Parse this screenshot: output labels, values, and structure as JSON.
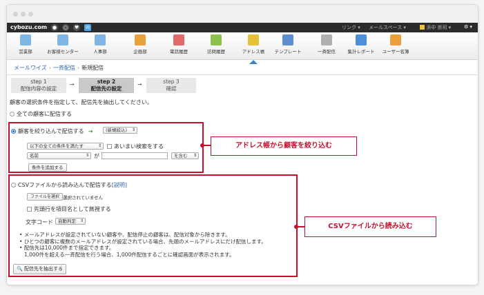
{
  "topbar": {
    "logo": "cybozu.com",
    "links": "リンク ▾",
    "mailspace": "メールスペース ▾",
    "user": "浜中 崇司 ▾",
    "settings": "⚙ ▾"
  },
  "apps": [
    {
      "label": "営業部"
    },
    {
      "label": "お客様センター"
    },
    {
      "label": "人事部"
    },
    {
      "label": "企画部"
    },
    {
      "label": "電話履歴"
    },
    {
      "label": "訪問履歴"
    },
    {
      "label": "アドレス帳"
    },
    {
      "label": "テンプレート"
    },
    {
      "label": "一斉配信"
    },
    {
      "label": "集計レポート"
    },
    {
      "label": "ユーザー名簿"
    }
  ],
  "breadcrumb": {
    "app": "メールワイズ",
    "section": "一斉配信",
    "current": "新規配信"
  },
  "steps": [
    {
      "title": "step 1",
      "label": "配信内容の設定"
    },
    {
      "title": "step 2",
      "label": "配信先の設定"
    },
    {
      "title": "step 3",
      "label": "確認"
    }
  ],
  "instruction": "顧客の選択条件を指定して、配信先を抽出してください。",
  "all_customers_label": "全ての顧客に配信する",
  "filter": {
    "label": "顧客を絞り込んで配信する",
    "filter_select": "(新規絞込)",
    "condition_select": "以下の全ての条件を満たす",
    "fuzzy_label": "あいまい検索をする",
    "field_select": "名前",
    "particle": "が",
    "match_select": "を含む",
    "add_condition": "条件を追加する"
  },
  "csv": {
    "label": "CSVファイルから読み込んで配信する",
    "help_link": "[説明]",
    "file_button": "ファイルを選択",
    "file_status": "選択されていません",
    "ignore_header": "先頭行を項目名として無視する",
    "charset_label": "文字コード",
    "charset_select": "自動判定"
  },
  "notes": [
    "メールアドレスが設定されていない顧客や、配信停止の顧客は、配信対象から除きます。",
    "ひとつの顧客に複数のメールアドレスが設定されている場合、先頭のメールアドレスにだけ配信します。",
    "配信先は10,000件まで指定できます。",
    "1,000件を超える一斉配信を行う場合、1,000件配信するごとに確認画面が表示されます。"
  ],
  "extract_button": "配信先を抽出する",
  "callouts": {
    "address_book": "アドレス帳から顧客を絞り込む",
    "csv": "CSVファイルから読み込む"
  },
  "colors": {
    "annotation": "#c8102e",
    "link": "#2a63b0",
    "topbar": "#2b2b2b"
  }
}
